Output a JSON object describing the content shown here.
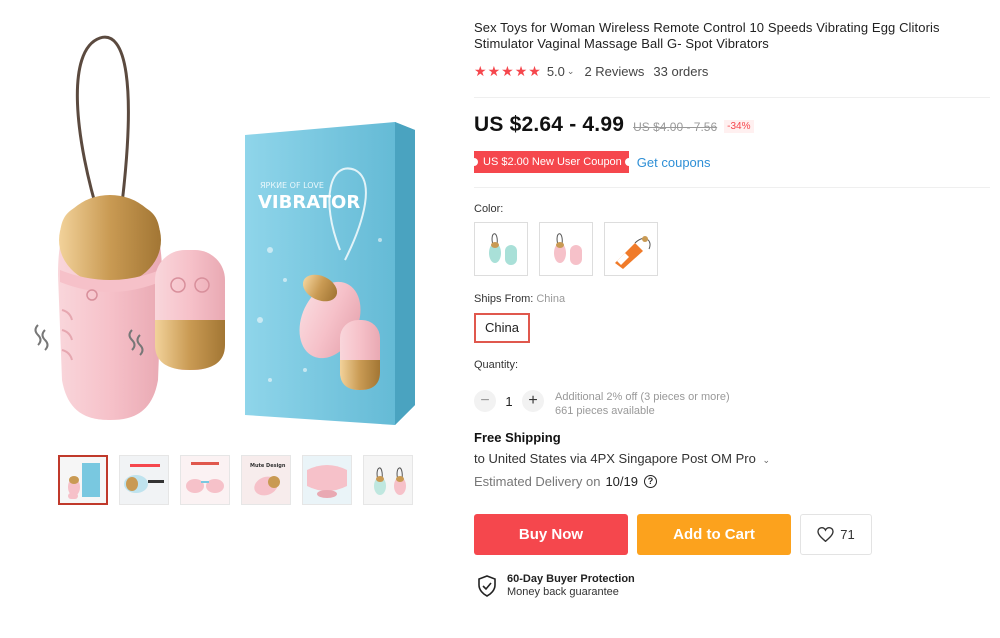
{
  "product": {
    "title": "Sex Toys for Woman Wireless Remote Control 10 Speeds Vibrating Egg Clitoris Stimulator Vaginal Massage Ball G- Spot Vibrators",
    "hero_box_text": "VIBRATOR",
    "hero_box_subtext": "ЯРКИЕ OF LOVE",
    "thumbnail_labels": [
      "",
      "",
      "",
      "Mute Design",
      "",
      ""
    ],
    "thumbnail_count": 6
  },
  "rating": {
    "stars": 5,
    "value": "5.0",
    "reviews": "2 Reviews",
    "orders": "33 orders"
  },
  "price": {
    "current": "US $2.64 - 4.99",
    "original": "US $4.00 - 7.56",
    "discount": "-34%"
  },
  "coupon": {
    "badge": "US $2.00 New User Coupon",
    "link": "Get coupons"
  },
  "color": {
    "label": "Color:",
    "options": [
      "mint",
      "pink",
      "orange"
    ]
  },
  "ships": {
    "label": "Ships From:",
    "selected_inline": "China",
    "option": "China"
  },
  "quantity": {
    "label": "Quantity:",
    "value": "1",
    "minus": "−",
    "plus": "+",
    "discount_note": "Additional 2% off (3 pieces or more)",
    "available": "661 pieces available"
  },
  "shipping": {
    "title": "Free Shipping",
    "route": "to United States via 4PX Singapore Post OM Pro",
    "delivery_label": "Estimated Delivery on",
    "delivery_date": "10/19",
    "help": "?"
  },
  "actions": {
    "buy_now": "Buy Now",
    "add_to_cart": "Add to Cart",
    "wishlist_count": "71"
  },
  "protection": {
    "title": "60-Day Buyer Protection",
    "subtitle": "Money back guarantee"
  },
  "colors": {
    "accent_red": "#f5474d",
    "cart_orange": "#fca21d",
    "link_blue": "#2e8fd6",
    "product_pink": "#f6c5cc",
    "box_blue": "#79c8e0"
  }
}
